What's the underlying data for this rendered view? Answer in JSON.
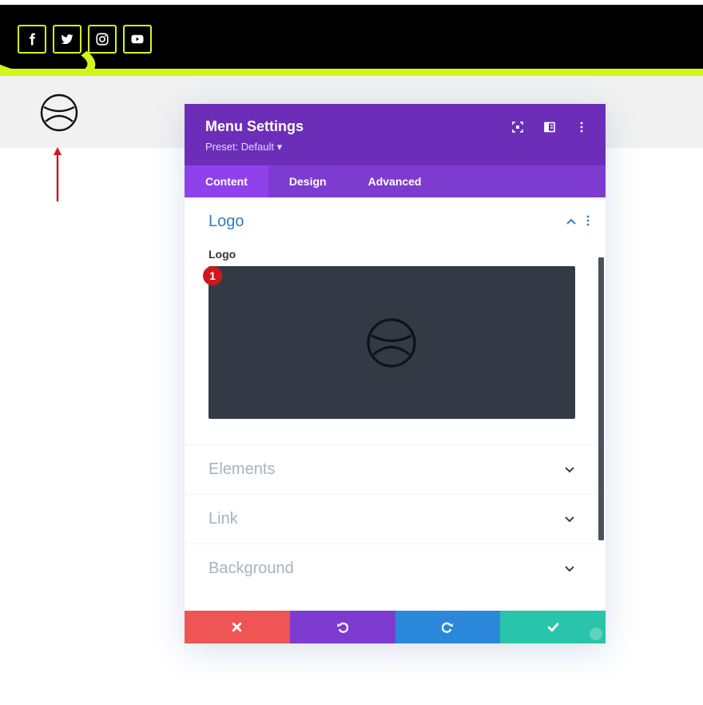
{
  "social": {
    "items": [
      {
        "name": "facebook",
        "icon": "facebook-icon"
      },
      {
        "name": "twitter",
        "icon": "twitter-icon"
      },
      {
        "name": "instagram",
        "icon": "instagram-icon"
      },
      {
        "name": "youtube",
        "icon": "youtube-icon"
      }
    ],
    "accent_color": "#d4f51a"
  },
  "modal": {
    "title": "Menu Settings",
    "preset": "Preset: Default ▾",
    "header_color": "#6c2eb9",
    "tabs": [
      {
        "label": "Content",
        "active": true
      },
      {
        "label": "Design",
        "active": false
      },
      {
        "label": "Advanced",
        "active": false
      }
    ],
    "logo_section": {
      "title": "Logo",
      "field_label": "Logo",
      "badge": "1"
    },
    "collapsed_sections": [
      {
        "title": "Elements"
      },
      {
        "title": "Link"
      },
      {
        "title": "Background"
      }
    ],
    "footer": {
      "close_color": "#ef5555",
      "undo_color": "#7e3bd0",
      "redo_color": "#2b87da",
      "save_color": "#29c4a9"
    }
  }
}
